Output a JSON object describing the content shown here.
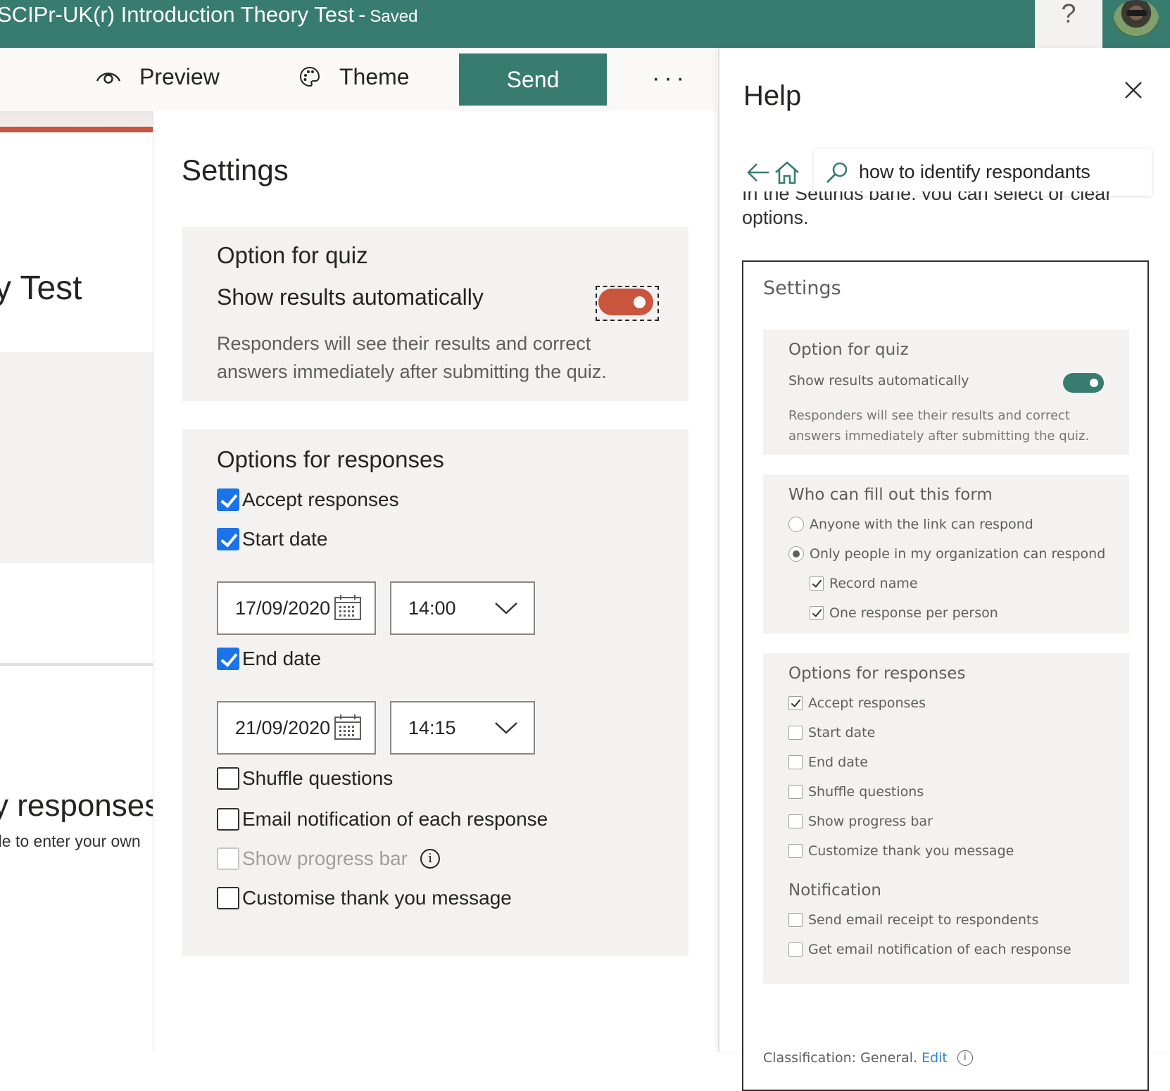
{
  "header": {
    "doc_title": "SCIPr-UK(r) Introduction Theory Test",
    "separator": "-",
    "save_status": "Saved",
    "help_icon": "?",
    "avatar_icon": "user-avatar"
  },
  "toolbar": {
    "preview_label": "Preview",
    "theme_label": "Theme",
    "send_label": "Send",
    "more_label": "···"
  },
  "form_strip": {
    "title_fragment": "y Test",
    "heading_fragment": "y responses",
    "sub_fragment": "de to enter your own"
  },
  "settings": {
    "title": "Settings",
    "quiz": {
      "title": "Option for quiz",
      "show_results_label": "Show results automatically",
      "show_results_on": true,
      "description": "Responders will see their results and correct answers immediately after submitting the quiz."
    },
    "responses": {
      "title": "Options for responses",
      "accept_responses": "Accept responses",
      "start_date_label": "Start date",
      "start_date": "17/09/2020",
      "start_time": "14:00",
      "end_date_label": "End date",
      "end_date": "21/09/2020",
      "end_time": "14:15",
      "shuffle_questions": "Shuffle questions",
      "email_notification": "Email notification of each response",
      "show_progress_bar": "Show progress bar",
      "info_icon": "i",
      "customise_thank_you": "Customise thank you message"
    }
  },
  "help": {
    "title": "Help",
    "search_value": "how to identify respondants",
    "cut_off_line": "In the Settings pane, you can select or clear",
    "options_text": "options.",
    "screenshot": {
      "title": "Settings",
      "quiz_title": "Option for quiz",
      "show_results_label": "Show results automatically",
      "quiz_desc": "Responders will see their results and correct answers immediately after submitting the quiz.",
      "who_title": "Who can fill out this form",
      "anyone": "Anyone with the link can respond",
      "only_org": "Only people in my organization can respond",
      "record_name": "Record name",
      "one_response": "One response per person",
      "resp_title": "Options for responses",
      "accept": "Accept responses",
      "start_date": "Start date",
      "end_date": "End date",
      "shuffle": "Shuffle questions",
      "progress": "Show progress bar",
      "customize": "Customize thank you message",
      "notification_title": "Notification",
      "send_receipt": "Send email receipt to respondents",
      "get_notification": "Get email notification of each response",
      "classification": "Classification: General.",
      "edit": "Edit",
      "info_icon": "i"
    }
  },
  "colors": {
    "brand": "#387c6f",
    "accent": "#c9553d",
    "checkbox": "#1a73e8",
    "link": "#2b88d8"
  }
}
